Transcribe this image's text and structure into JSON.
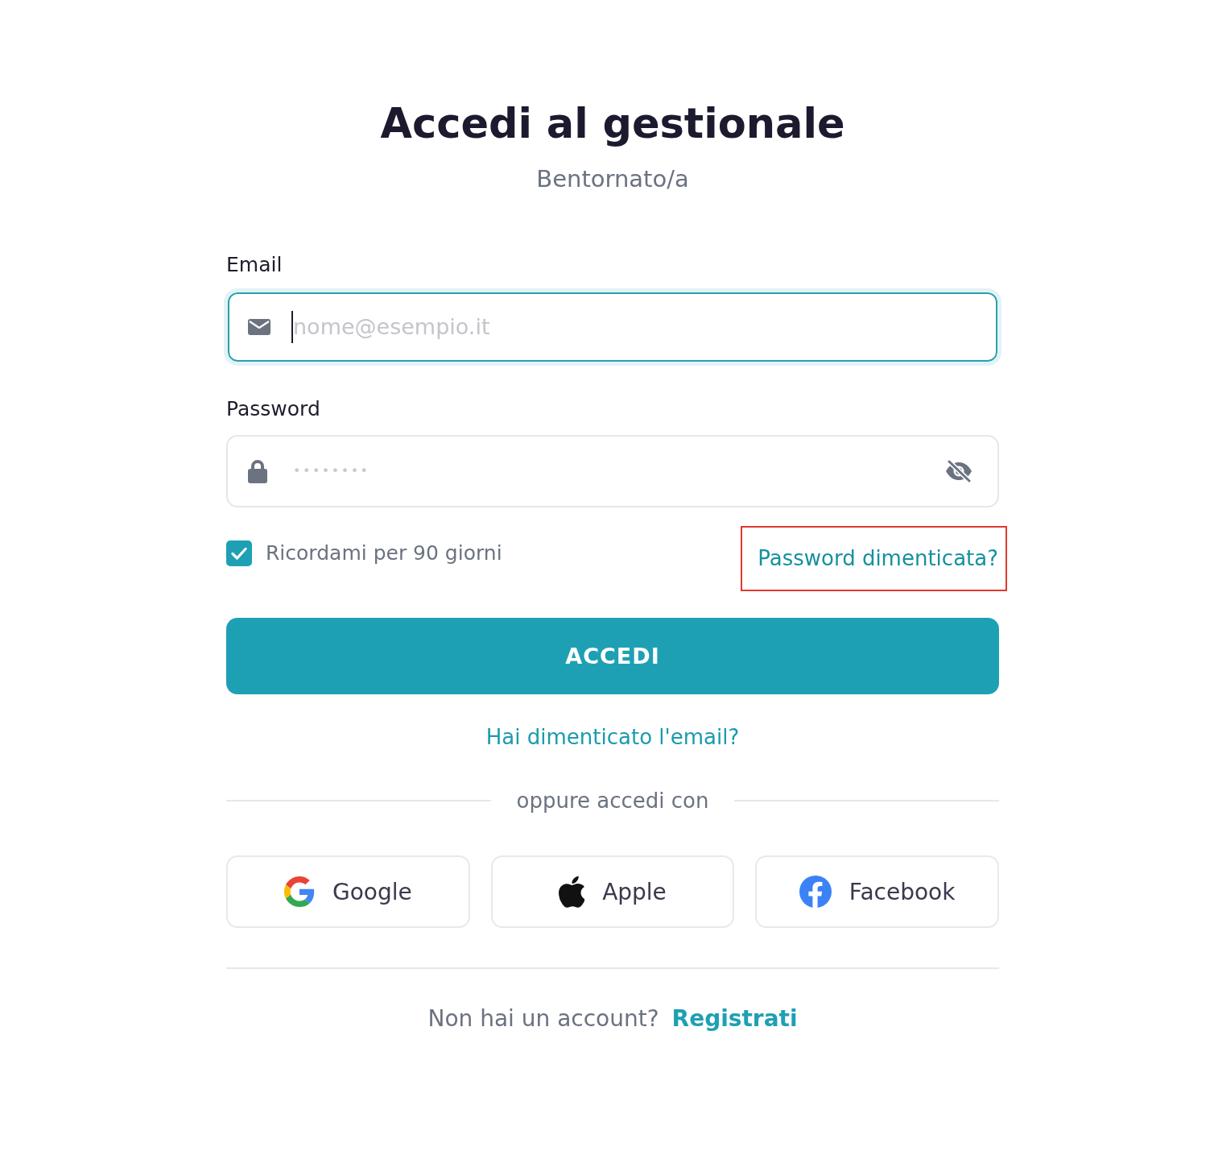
{
  "header": {
    "title": "Accedi al gestionale",
    "subtitle": "Bentornato/a"
  },
  "form": {
    "email": {
      "label": "Email",
      "placeholder": "nome@esempio.it",
      "focused": true
    },
    "password": {
      "label": "Password",
      "placeholder": "••••••••",
      "revealed": false
    },
    "remember": {
      "label": "Ricordami per 90 giorni",
      "checked": true
    },
    "forgot_password": {
      "label": "Password dimenticata?",
      "highlighted": true
    },
    "submit": {
      "label": "ACCEDI"
    },
    "forgot_email": {
      "label": "Hai dimenticato l'email?"
    }
  },
  "social": {
    "divider": "oppure accedi con",
    "buttons": [
      {
        "kind": "google",
        "label": "Google"
      },
      {
        "kind": "apple",
        "label": "Apple"
      },
      {
        "kind": "facebook",
        "label": "Facebook"
      }
    ]
  },
  "footer": {
    "prompt": "Non hai un account?",
    "link": "Registrati"
  }
}
